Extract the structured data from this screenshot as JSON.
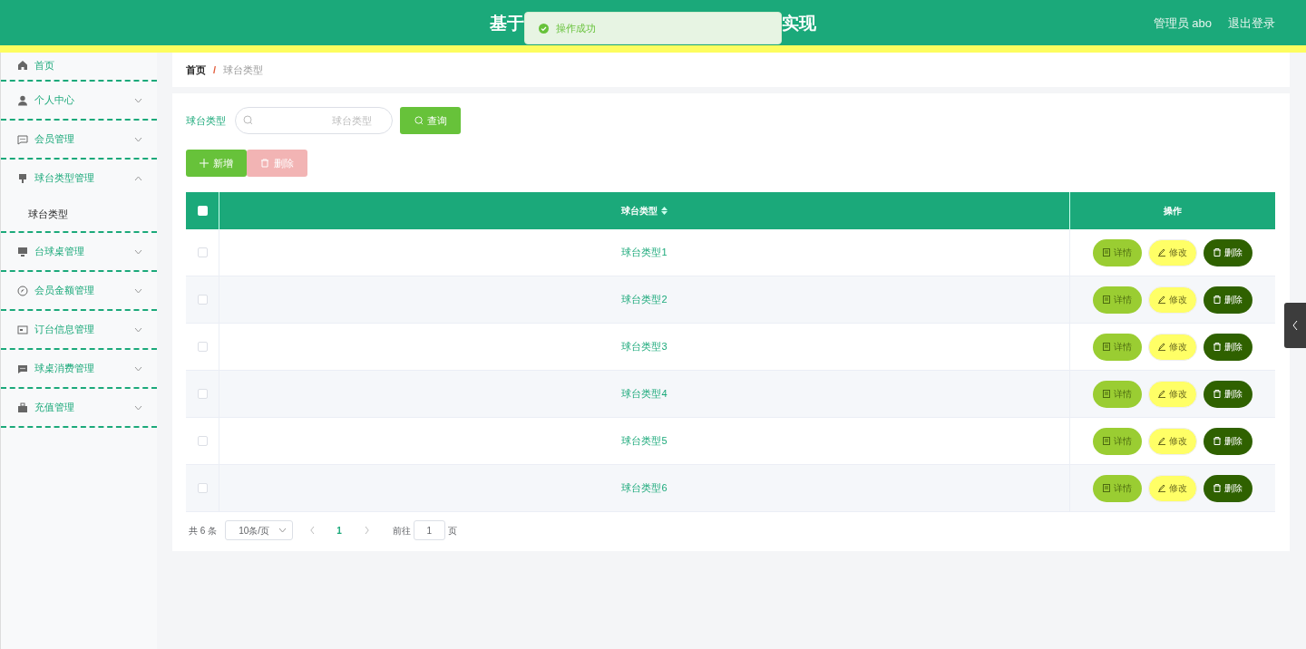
{
  "header": {
    "title_parts": [
      "基于",
      "实现"
    ],
    "user": "管理员 abo",
    "logout": "退出登录"
  },
  "toast": {
    "message": "操作成功"
  },
  "sidebar": {
    "items": [
      {
        "label": "首页"
      },
      {
        "label": "个人中心",
        "expanded": false
      },
      {
        "label": "会员管理",
        "expanded": false
      },
      {
        "label": "球台类型管理",
        "expanded": true,
        "children": [
          {
            "label": "球台类型"
          }
        ]
      },
      {
        "label": "台球桌管理",
        "expanded": false
      },
      {
        "label": "会员金额管理",
        "expanded": false
      },
      {
        "label": "订台信息管理",
        "expanded": false
      },
      {
        "label": "球桌消费管理",
        "expanded": false
      },
      {
        "label": "充值管理",
        "expanded": false
      }
    ]
  },
  "breadcrumb": {
    "items": [
      "首页",
      "球台类型"
    ],
    "separator": "/"
  },
  "search": {
    "label": "球台类型",
    "placeholder": "球台类型",
    "button": "查询"
  },
  "actions": [
    {
      "label": "新增",
      "kind": "add",
      "disabled": false
    },
    {
      "label": "删除",
      "kind": "delete",
      "disabled": true
    }
  ],
  "table": {
    "columns": [
      "球台类型",
      "操作"
    ],
    "all_checked": false,
    "rows": [
      {
        "type": "球台类型1",
        "checked": false,
        "buttons": [
          {
            "label": "详情",
            "kind": "detail"
          },
          {
            "label": "修改",
            "kind": "edit"
          },
          {
            "label": "删除",
            "kind": "delete"
          }
        ]
      },
      {
        "type": "球台类型2",
        "checked": false,
        "buttons": [
          {
            "label": "详情",
            "kind": "detail"
          },
          {
            "label": "修改",
            "kind": "edit"
          },
          {
            "label": "删除",
            "kind": "delete"
          }
        ]
      },
      {
        "type": "球台类型3",
        "checked": false,
        "buttons": [
          {
            "label": "详情",
            "kind": "detail"
          },
          {
            "label": "修改",
            "kind": "edit"
          },
          {
            "label": "删除",
            "kind": "delete"
          }
        ]
      },
      {
        "type": "球台类型4",
        "checked": false,
        "buttons": [
          {
            "label": "详情",
            "kind": "detail"
          },
          {
            "label": "修改",
            "kind": "edit"
          },
          {
            "label": "删除",
            "kind": "delete"
          }
        ]
      },
      {
        "type": "球台类型5",
        "checked": false,
        "buttons": [
          {
            "label": "详情",
            "kind": "detail"
          },
          {
            "label": "修改",
            "kind": "edit"
          },
          {
            "label": "删除",
            "kind": "delete"
          }
        ]
      },
      {
        "type": "球台类型6",
        "checked": false,
        "buttons": [
          {
            "label": "详情",
            "kind": "detail"
          },
          {
            "label": "修改",
            "kind": "edit"
          },
          {
            "label": "删除",
            "kind": "delete"
          }
        ]
      }
    ]
  },
  "pagination": {
    "total": "共 6 条",
    "page_size": "10条/页",
    "current": "1",
    "goto_label": "前往",
    "goto_value": "1",
    "page_suffix": "页"
  }
}
